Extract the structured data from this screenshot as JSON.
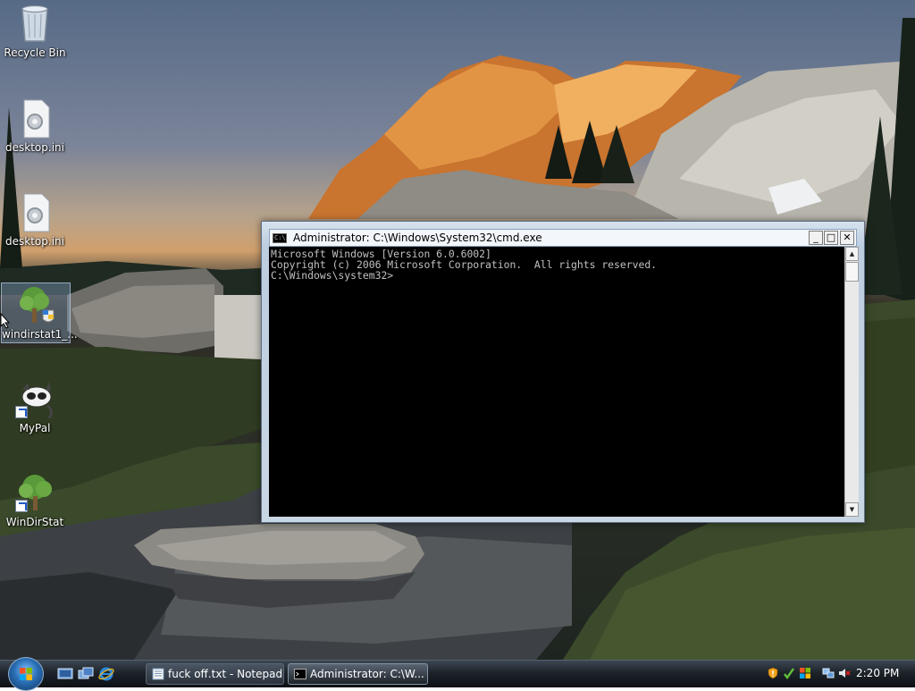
{
  "desktop": {
    "icons": [
      {
        "name": "recycle-bin-icon",
        "label": "Recycle Bin"
      },
      {
        "name": "desktop-ini-icon",
        "label": "desktop.ini"
      },
      {
        "name": "desktop-ini-icon-2",
        "label": "desktop.ini"
      },
      {
        "name": "windirstat-setup-icon",
        "label": "windirstat1_..."
      },
      {
        "name": "mypal-icon",
        "label": "MyPal"
      },
      {
        "name": "windirstat-icon",
        "label": "WinDirStat"
      }
    ]
  },
  "cmd_window": {
    "title": "Administrator: C:\\Windows\\System32\\cmd.exe",
    "icon_text": "C:\\",
    "controls": {
      "minimize": "_",
      "maximize": "□",
      "close": "✕"
    },
    "console_lines": [
      "Microsoft Windows [Version 6.0.6002]",
      "Copyright (c) 2006 Microsoft Corporation.  All rights reserved.",
      "",
      "C:\\Windows\\system32>"
    ],
    "scroll_up": "▲",
    "scroll_down": "▼"
  },
  "taskbar": {
    "quick_launch": [
      "show-desktop-icon",
      "switch-windows-icon",
      "internet-explorer-icon"
    ],
    "buttons": [
      {
        "label": "fuck off.txt - Notepad",
        "icon": "notepad-icon",
        "active": false
      },
      {
        "label": "Administrator: C:\\W...",
        "icon": "cmd-icon",
        "active": true
      }
    ],
    "tray_icons": [
      "security-shield-icon",
      "network-icon",
      "volume-muted-icon"
    ],
    "clock": "2:20 PM"
  },
  "colors": {
    "console_bg": "#000000",
    "console_text": "#c0c0c0",
    "taskbar": "#1d232a"
  }
}
